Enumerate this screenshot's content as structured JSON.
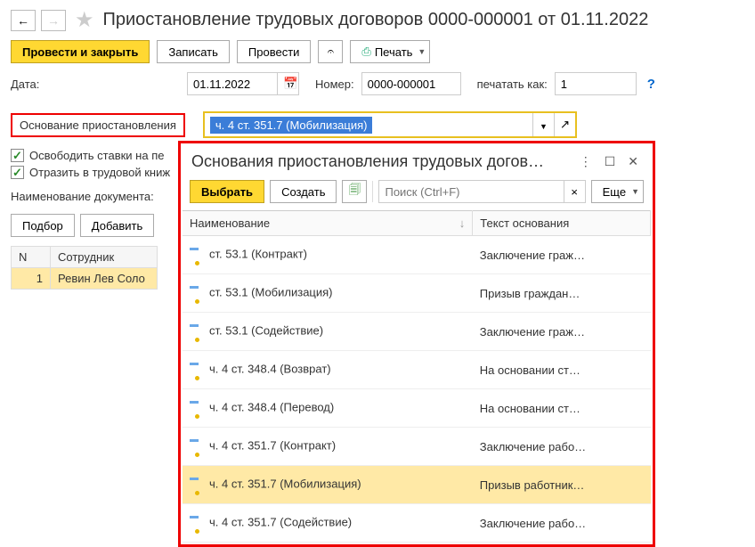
{
  "header": {
    "title": "Приостановление трудовых договоров 0000-000001 от 01.11.2022"
  },
  "toolbar": {
    "post_close": "Провести и закрыть",
    "write": "Записать",
    "post": "Провести",
    "print": "Печать"
  },
  "form": {
    "date_label": "Дата:",
    "date_value": "01.11.2022",
    "number_label": "Номер:",
    "number_value": "0000-000001",
    "print_as_label": "печатать как:",
    "print_as_value": "1",
    "basis_label": "Основание приостановления",
    "basis_value": "ч. 4 ст. 351.7 (Мобилизация)",
    "check_free_rates": "Освободить ставки на пе",
    "check_workbook": "Отразить в трудовой книж",
    "docname_label": "Наименование документа:",
    "pick": "Подбор",
    "add": "Добавить"
  },
  "table": {
    "col_n": "N",
    "col_emp": "Сотрудник",
    "rows": [
      {
        "n": "1",
        "emp": "Ревин Лев Соло"
      }
    ]
  },
  "popup": {
    "title": "Основания приостановления трудовых догов…",
    "select": "Выбрать",
    "create": "Создать",
    "search_placeholder": "Поиск (Ctrl+F)",
    "more": "Еще",
    "col_name": "Наименование",
    "col_text": "Текст основания",
    "rows": [
      {
        "name": "ст. 53.1 (Контракт)",
        "text": "Заключение граж…",
        "sel": false
      },
      {
        "name": "ст. 53.1 (Мобилизация)",
        "text": "Призыв граждан…",
        "sel": false
      },
      {
        "name": "ст. 53.1 (Содействие)",
        "text": "Заключение граж…",
        "sel": false
      },
      {
        "name": "ч. 4 ст. 348.4 (Возврат)",
        "text": "На основании ст…",
        "sel": false
      },
      {
        "name": "ч. 4 ст. 348.4 (Перевод)",
        "text": "На основании ст…",
        "sel": false
      },
      {
        "name": "ч. 4 ст. 351.7 (Контракт)",
        "text": "Заключение рабо…",
        "sel": false
      },
      {
        "name": "ч. 4 ст. 351.7 (Мобилизация)",
        "text": "Призыв работник…",
        "sel": true
      },
      {
        "name": "ч. 4 ст. 351.7 (Содействие)",
        "text": "Заключение рабо…",
        "sel": false
      }
    ]
  }
}
